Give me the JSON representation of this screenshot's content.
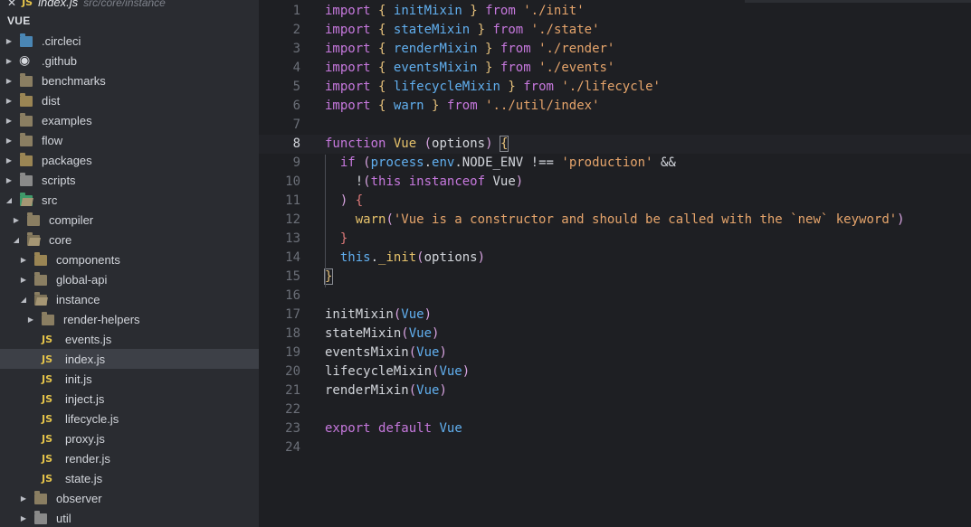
{
  "open_editor": {
    "close_glyph": "✕",
    "badge": "JS",
    "filename": "index.js",
    "path": "src/core/instance"
  },
  "explorer": {
    "section_title": "VUE",
    "items": [
      {
        "label": ".circleci",
        "type": "folder",
        "variant": "blue",
        "depth": 0,
        "expanded": false
      },
      {
        "label": ".github",
        "type": "folder",
        "variant": "cat",
        "depth": 0,
        "expanded": false
      },
      {
        "label": "benchmarks",
        "type": "folder",
        "variant": "",
        "depth": 0,
        "expanded": false
      },
      {
        "label": "dist",
        "type": "folder",
        "variant": "special",
        "depth": 0,
        "expanded": false
      },
      {
        "label": "examples",
        "type": "folder",
        "variant": "",
        "depth": 0,
        "expanded": false
      },
      {
        "label": "flow",
        "type": "folder",
        "variant": "",
        "depth": 0,
        "expanded": false
      },
      {
        "label": "packages",
        "type": "folder",
        "variant": "special",
        "depth": 0,
        "expanded": false
      },
      {
        "label": "scripts",
        "type": "folder",
        "variant": "gear",
        "depth": 0,
        "expanded": false
      },
      {
        "label": "src",
        "type": "folder",
        "variant": "src",
        "depth": 0,
        "expanded": true
      },
      {
        "label": "compiler",
        "type": "folder",
        "variant": "",
        "depth": 1,
        "expanded": false
      },
      {
        "label": "core",
        "type": "folder",
        "variant": "",
        "depth": 1,
        "expanded": true
      },
      {
        "label": "components",
        "type": "folder",
        "variant": "special",
        "depth": 2,
        "expanded": false
      },
      {
        "label": "global-api",
        "type": "folder",
        "variant": "",
        "depth": 2,
        "expanded": false
      },
      {
        "label": "instance",
        "type": "folder",
        "variant": "",
        "depth": 2,
        "expanded": true
      },
      {
        "label": "render-helpers",
        "type": "folder",
        "variant": "",
        "depth": 3,
        "expanded": false
      },
      {
        "label": "events.js",
        "type": "file",
        "depth": 3
      },
      {
        "label": "index.js",
        "type": "file",
        "depth": 3,
        "selected": true
      },
      {
        "label": "init.js",
        "type": "file",
        "depth": 3
      },
      {
        "label": "inject.js",
        "type": "file",
        "depth": 3
      },
      {
        "label": "lifecycle.js",
        "type": "file",
        "depth": 3
      },
      {
        "label": "proxy.js",
        "type": "file",
        "depth": 3
      },
      {
        "label": "render.js",
        "type": "file",
        "depth": 3
      },
      {
        "label": "state.js",
        "type": "file",
        "depth": 3
      },
      {
        "label": "observer",
        "type": "folder",
        "variant": "",
        "depth": 2,
        "expanded": false
      },
      {
        "label": "util",
        "type": "folder",
        "variant": "gear",
        "depth": 2,
        "expanded": false
      }
    ],
    "file_badge": "JS"
  },
  "editor": {
    "current_line": 8,
    "lines": [
      [
        [
          "k",
          "import"
        ],
        [
          "id",
          " "
        ],
        [
          "b",
          "{"
        ],
        [
          "id",
          " "
        ],
        [
          "v",
          "initMixin"
        ],
        [
          "id",
          " "
        ],
        [
          "b",
          "}"
        ],
        [
          "id",
          " "
        ],
        [
          "k",
          "from"
        ],
        [
          "id",
          " "
        ],
        [
          "s2",
          "'./init'"
        ]
      ],
      [
        [
          "k",
          "import"
        ],
        [
          "id",
          " "
        ],
        [
          "b",
          "{"
        ],
        [
          "id",
          " "
        ],
        [
          "v",
          "stateMixin"
        ],
        [
          "id",
          " "
        ],
        [
          "b",
          "}"
        ],
        [
          "id",
          " "
        ],
        [
          "k",
          "from"
        ],
        [
          "id",
          " "
        ],
        [
          "s2",
          "'./state'"
        ]
      ],
      [
        [
          "k",
          "import"
        ],
        [
          "id",
          " "
        ],
        [
          "b",
          "{"
        ],
        [
          "id",
          " "
        ],
        [
          "v",
          "renderMixin"
        ],
        [
          "id",
          " "
        ],
        [
          "b",
          "}"
        ],
        [
          "id",
          " "
        ],
        [
          "k",
          "from"
        ],
        [
          "id",
          " "
        ],
        [
          "s2",
          "'./render'"
        ]
      ],
      [
        [
          "k",
          "import"
        ],
        [
          "id",
          " "
        ],
        [
          "b",
          "{"
        ],
        [
          "id",
          " "
        ],
        [
          "v",
          "eventsMixin"
        ],
        [
          "id",
          " "
        ],
        [
          "b",
          "}"
        ],
        [
          "id",
          " "
        ],
        [
          "k",
          "from"
        ],
        [
          "id",
          " "
        ],
        [
          "s2",
          "'./events'"
        ]
      ],
      [
        [
          "k",
          "import"
        ],
        [
          "id",
          " "
        ],
        [
          "b",
          "{"
        ],
        [
          "id",
          " "
        ],
        [
          "v",
          "lifecycleMixin"
        ],
        [
          "id",
          " "
        ],
        [
          "b",
          "}"
        ],
        [
          "id",
          " "
        ],
        [
          "k",
          "from"
        ],
        [
          "id",
          " "
        ],
        [
          "s2",
          "'./lifecycle'"
        ]
      ],
      [
        [
          "k",
          "import"
        ],
        [
          "id",
          " "
        ],
        [
          "b",
          "{"
        ],
        [
          "id",
          " "
        ],
        [
          "v",
          "warn"
        ],
        [
          "id",
          " "
        ],
        [
          "b",
          "}"
        ],
        [
          "id",
          " "
        ],
        [
          "k",
          "from"
        ],
        [
          "id",
          " "
        ],
        [
          "s2",
          "'../util/index'"
        ]
      ],
      [],
      [
        [
          "k",
          "function"
        ],
        [
          "id",
          " "
        ],
        [
          "fn",
          "Vue"
        ],
        [
          "id",
          " "
        ],
        [
          "p",
          "("
        ],
        [
          "id",
          "options"
        ],
        [
          "p",
          ")"
        ],
        [
          "id",
          " "
        ],
        [
          "bm",
          "{"
        ]
      ],
      [
        [
          "id",
          "  "
        ],
        [
          "k",
          "if"
        ],
        [
          "id",
          " "
        ],
        [
          "p",
          "("
        ],
        [
          "v",
          "process"
        ],
        [
          "id",
          "."
        ],
        [
          "v",
          "env"
        ],
        [
          "id",
          "."
        ],
        [
          "id",
          "NODE_ENV"
        ],
        [
          "id",
          " "
        ],
        [
          "op",
          "!=="
        ],
        [
          "id",
          " "
        ],
        [
          "s2",
          "'production'"
        ],
        [
          "id",
          " "
        ],
        [
          "op",
          "&&"
        ]
      ],
      [
        [
          "id",
          "    "
        ],
        [
          "op",
          "!"
        ],
        [
          "p",
          "("
        ],
        [
          "k",
          "this"
        ],
        [
          "id",
          " "
        ],
        [
          "k",
          "instanceof"
        ],
        [
          "id",
          " "
        ],
        [
          "id",
          "Vue"
        ],
        [
          "p",
          ")"
        ]
      ],
      [
        [
          "id",
          "  "
        ],
        [
          "p",
          ")"
        ],
        [
          "id",
          " "
        ],
        [
          "sy",
          "{"
        ]
      ],
      [
        [
          "id",
          "    "
        ],
        [
          "fn",
          "warn"
        ],
        [
          "p",
          "("
        ],
        [
          "s2",
          "'Vue is a constructor and should be called with the `new` keyword'"
        ],
        [
          "p",
          ")"
        ]
      ],
      [
        [
          "id",
          "  "
        ],
        [
          "sy",
          "}"
        ]
      ],
      [
        [
          "id",
          "  "
        ],
        [
          "v",
          "this"
        ],
        [
          "id",
          "."
        ],
        [
          "fn",
          "_init"
        ],
        [
          "p",
          "("
        ],
        [
          "id",
          "options"
        ],
        [
          "p",
          ")"
        ]
      ],
      [
        [
          "bm",
          "}"
        ]
      ],
      [],
      [
        [
          "id",
          "initMixin"
        ],
        [
          "p",
          "("
        ],
        [
          "v",
          "Vue"
        ],
        [
          "p",
          ")"
        ]
      ],
      [
        [
          "id",
          "stateMixin"
        ],
        [
          "p",
          "("
        ],
        [
          "v",
          "Vue"
        ],
        [
          "p",
          ")"
        ]
      ],
      [
        [
          "id",
          "eventsMixin"
        ],
        [
          "p",
          "("
        ],
        [
          "v",
          "Vue"
        ],
        [
          "p",
          ")"
        ]
      ],
      [
        [
          "id",
          "lifecycleMixin"
        ],
        [
          "p",
          "("
        ],
        [
          "v",
          "Vue"
        ],
        [
          "p",
          ")"
        ]
      ],
      [
        [
          "id",
          "renderMixin"
        ],
        [
          "p",
          "("
        ],
        [
          "v",
          "Vue"
        ],
        [
          "p",
          ")"
        ]
      ],
      [],
      [
        [
          "k",
          "export"
        ],
        [
          "id",
          " "
        ],
        [
          "k",
          "default"
        ],
        [
          "id",
          " "
        ],
        [
          "v",
          "Vue"
        ]
      ],
      []
    ]
  },
  "colors": {
    "sidebar_bg": "#2a2c31",
    "editor_bg": "#1e1f23",
    "selected_row": "#3d4047",
    "js_badge": "#e5c44b"
  }
}
